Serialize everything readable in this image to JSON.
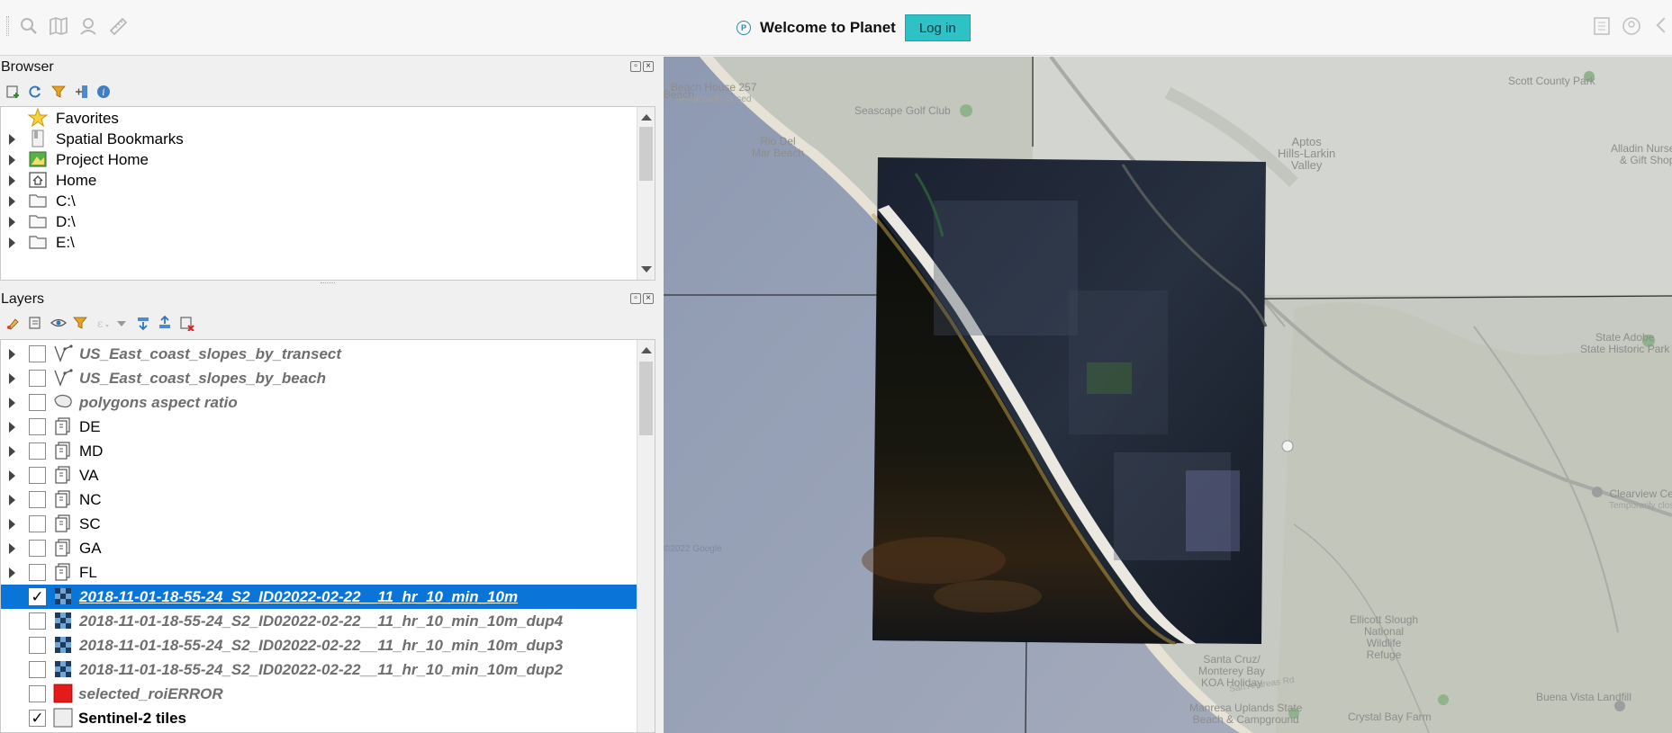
{
  "toolbar": {
    "icons": [
      "search-icon",
      "map-icon",
      "user-icon",
      "ruler-icon"
    ],
    "right_icons": [
      "document-icon",
      "account-icon"
    ],
    "planet": {
      "logo_letter": "P",
      "welcome": "Welcome to Planet",
      "login_label": "Log in"
    }
  },
  "browser": {
    "title": "Browser",
    "toolbar_icons": [
      "add-icon",
      "refresh-icon",
      "filter-icon",
      "collapse-icon",
      "info-icon"
    ],
    "items": [
      {
        "label": "Favorites",
        "icon": "star-icon",
        "expandable": false
      },
      {
        "label": "Spatial Bookmarks",
        "icon": "bookmark-icon",
        "expandable": true
      },
      {
        "label": "Project Home",
        "icon": "project-home-icon",
        "expandable": true
      },
      {
        "label": "Home",
        "icon": "home-icon",
        "expandable": true
      },
      {
        "label": "C:\\",
        "icon": "folder-icon",
        "expandable": true
      },
      {
        "label": "D:\\",
        "icon": "folder-icon",
        "expandable": true
      },
      {
        "label": "E:\\",
        "icon": "folder-icon",
        "expandable": true
      }
    ]
  },
  "layers": {
    "title": "Layers",
    "toolbar_icons": [
      "style-icon",
      "add-group-icon",
      "visibility-icon",
      "filter-icon",
      "expression-filter-icon",
      "expand-all-icon",
      "collapse-all-icon",
      "remove-layer-icon"
    ],
    "items": [
      {
        "label": "US_East_coast_slopes_by_transect",
        "type": "line",
        "checked": false,
        "expandable": true,
        "style": "italic-gray"
      },
      {
        "label": "US_East_coast_slopes_by_beach",
        "type": "line",
        "checked": false,
        "expandable": true,
        "style": "italic-gray"
      },
      {
        "label": "polygons aspect ratio",
        "type": "polygon",
        "checked": false,
        "expandable": true,
        "style": "italic-gray"
      },
      {
        "label": "DE",
        "type": "group",
        "checked": false,
        "expandable": true,
        "style": "normal"
      },
      {
        "label": "MD",
        "type": "group",
        "checked": false,
        "expandable": true,
        "style": "normal"
      },
      {
        "label": "VA",
        "type": "group",
        "checked": false,
        "expandable": true,
        "style": "normal"
      },
      {
        "label": "NC",
        "type": "group",
        "checked": false,
        "expandable": true,
        "style": "normal"
      },
      {
        "label": "SC",
        "type": "group",
        "checked": false,
        "expandable": true,
        "style": "normal"
      },
      {
        "label": "GA",
        "type": "group",
        "checked": false,
        "expandable": true,
        "style": "normal"
      },
      {
        "label": "FL",
        "type": "group",
        "checked": false,
        "expandable": true,
        "style": "normal"
      },
      {
        "label": "2018-11-01-18-55-24_S2_ID02022-02-22__11_hr_10_min_10m",
        "type": "raster",
        "checked": true,
        "expandable": false,
        "style": "selected"
      },
      {
        "label": "2018-11-01-18-55-24_S2_ID02022-02-22__11_hr_10_min_10m_dup4",
        "type": "raster",
        "checked": false,
        "expandable": false,
        "style": "italic-gray"
      },
      {
        "label": "2018-11-01-18-55-24_S2_ID02022-02-22__11_hr_10_min_10m_dup3",
        "type": "raster",
        "checked": false,
        "expandable": false,
        "style": "italic-gray"
      },
      {
        "label": "2018-11-01-18-55-24_S2_ID02022-02-22__11_hr_10_min_10m_dup2",
        "type": "raster",
        "checked": false,
        "expandable": false,
        "style": "italic-gray"
      },
      {
        "label": "selected_roiERROR",
        "type": "fill-red",
        "checked": false,
        "expandable": false,
        "style": "italic-gray"
      },
      {
        "label": "Sentinel-2 tiles",
        "type": "fill-white",
        "checked": true,
        "expandable": false,
        "style": "bold"
      }
    ]
  },
  "map": {
    "labels": [
      {
        "text": "Beach House 257",
        "sub": "Temporarily closed"
      },
      {
        "text": "Seascape Golf Club"
      },
      {
        "text": "Rio Del\nMar Beach"
      },
      {
        "text": "Aptos\nHills-Larkin\nValley"
      },
      {
        "text": "Scott County Park"
      },
      {
        "text": "Alladin Nursery\n& Gift Shop"
      },
      {
        "text": "State Adobe\nState Historic Park"
      },
      {
        "text": "Clearview Ce",
        "sub": "Temporarily clos"
      },
      {
        "text": "Ellicott Slough\nNational\nWildlife\nRefuge"
      },
      {
        "text": "Santa Cruz/\nMonterey Bay\nKOA Holiday"
      },
      {
        "text": "Manresa Uplands State\nBeach & Campground"
      },
      {
        "text": "Buena Vista Landfill"
      },
      {
        "text": "Crystal Bay Farm"
      },
      {
        "text": "San Andreas Rd"
      },
      {
        "text": "Beach"
      },
      {
        "text": "©2022 Google"
      }
    ],
    "colors": {
      "ocean": "#8c98b0",
      "land": "#c9ccc4",
      "imagery_dark": "#121620"
    }
  }
}
